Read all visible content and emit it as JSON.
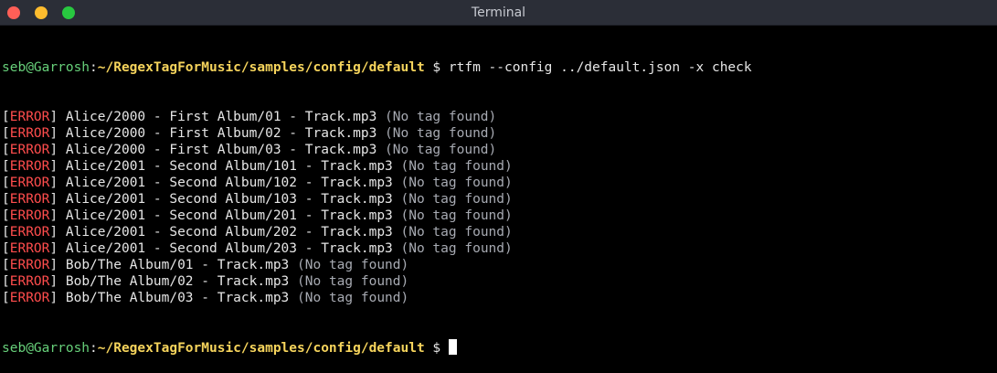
{
  "window": {
    "title": "Terminal",
    "buttons": [
      {
        "name": "close",
        "color": "#ff5f57"
      },
      {
        "name": "minimize",
        "color": "#febc2e"
      },
      {
        "name": "maximize",
        "color": "#28c840"
      }
    ]
  },
  "prompt": {
    "user_host": "seb@Garrosh",
    "colon": ":",
    "path": "~/RegexTagForMusic/samples/config/default",
    "symbol": " $ "
  },
  "command": "rtfm --config ../default.json -x check",
  "errors": [
    {
      "open": "[",
      "level": "ERROR",
      "close": "]",
      "file": " Alice/2000 - First Album/01 - Track.mp3 ",
      "message": "(No tag found)"
    },
    {
      "open": "[",
      "level": "ERROR",
      "close": "]",
      "file": " Alice/2000 - First Album/02 - Track.mp3 ",
      "message": "(No tag found)"
    },
    {
      "open": "[",
      "level": "ERROR",
      "close": "]",
      "file": " Alice/2000 - First Album/03 - Track.mp3 ",
      "message": "(No tag found)"
    },
    {
      "open": "[",
      "level": "ERROR",
      "close": "]",
      "file": " Alice/2001 - Second Album/101 - Track.mp3 ",
      "message": "(No tag found)"
    },
    {
      "open": "[",
      "level": "ERROR",
      "close": "]",
      "file": " Alice/2001 - Second Album/102 - Track.mp3 ",
      "message": "(No tag found)"
    },
    {
      "open": "[",
      "level": "ERROR",
      "close": "]",
      "file": " Alice/2001 - Second Album/103 - Track.mp3 ",
      "message": "(No tag found)"
    },
    {
      "open": "[",
      "level": "ERROR",
      "close": "]",
      "file": " Alice/2001 - Second Album/201 - Track.mp3 ",
      "message": "(No tag found)"
    },
    {
      "open": "[",
      "level": "ERROR",
      "close": "]",
      "file": " Alice/2001 - Second Album/202 - Track.mp3 ",
      "message": "(No tag found)"
    },
    {
      "open": "[",
      "level": "ERROR",
      "close": "]",
      "file": " Alice/2001 - Second Album/203 - Track.mp3 ",
      "message": "(No tag found)"
    },
    {
      "open": "[",
      "level": "ERROR",
      "close": "]",
      "file": " Bob/The Album/01 - Track.mp3 ",
      "message": "(No tag found)"
    },
    {
      "open": "[",
      "level": "ERROR",
      "close": "]",
      "file": " Bob/The Album/02 - Track.mp3 ",
      "message": "(No tag found)"
    },
    {
      "open": "[",
      "level": "ERROR",
      "close": "]",
      "file": " Bob/The Album/03 - Track.mp3 ",
      "message": "(No tag found)"
    }
  ],
  "colors": {
    "prompt_user": "#67d07a",
    "prompt_path": "#f6d45c",
    "error": "#ff4d4d",
    "message": "#a7aab2",
    "background": "#000000"
  }
}
